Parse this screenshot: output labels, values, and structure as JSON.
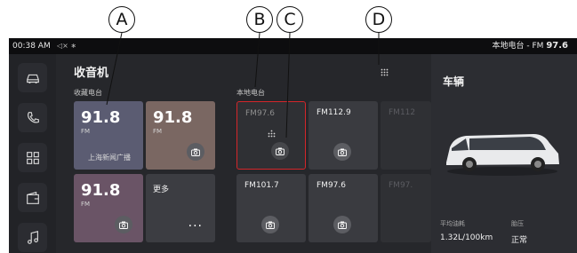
{
  "callouts": {
    "a": "A",
    "b": "B",
    "c": "C",
    "d": "D"
  },
  "statusbar": {
    "time": "00:38 AM",
    "status_icons": "◁× ∗",
    "radio_station": "本地电台 - FM",
    "radio_freq": "97.6"
  },
  "sidenav": {
    "items": [
      "car-icon",
      "phone-icon",
      "apps-grid-icon",
      "wallet-icon",
      "music-note-icon"
    ]
  },
  "radio": {
    "title": "收音机",
    "favorites_label": "收藏电台",
    "local_label": "本地电台",
    "favorites": [
      {
        "freq": "91.8",
        "unit": "FM",
        "station": "上海新闻广播",
        "color": "#5b5c72"
      },
      {
        "freq": "91.8",
        "unit": "FM",
        "station": "",
        "color": "#7a6762"
      },
      {
        "freq": "91.8",
        "unit": "FM",
        "station": "",
        "color": "#6a5466"
      }
    ],
    "more_label": "更多",
    "more_dots": "···",
    "local": [
      "FM97.6",
      "FM112.9",
      "FM112",
      "FM101.7",
      "FM97.6",
      "FM97."
    ]
  },
  "vehicle": {
    "title": "车辆",
    "fuel_label": "平均油耗",
    "fuel_value": "1.32L/100km",
    "tire_label": "胎压",
    "tire_value": "正常"
  },
  "colors": {
    "selected_border": "#d4262a",
    "background": "#1a1b1e"
  }
}
